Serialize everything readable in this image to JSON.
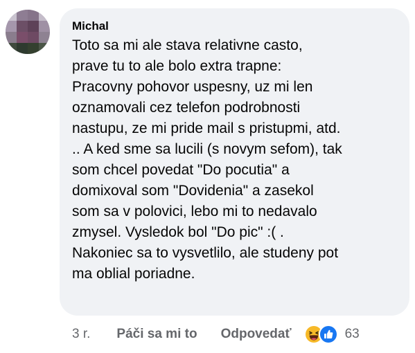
{
  "comment": {
    "author": "Michal",
    "lines": [
      "Toto sa mi ale stava relativne casto,",
      "prave tu to ale bolo extra trapne:",
      "Pracovny pohovor uspesny, uz mi len",
      "oznamovali cez telefon podrobnosti",
      "nastupu, ze mi pride mail s pristupmi, atd.",
      ".. A ked sme sa lucili (s novym sefom), tak",
      "som chcel povedat \"Do pocutia\" a",
      "domixoval som \"Dovidenia\" a zasekol",
      "som sa v polovici, lebo mi to nedavalo",
      "zmysel. Vysledok bol \"Do pic\" :( .",
      "Nakoniec sa to vysvetlilo, ale studeny pot",
      "ma oblial poriadne."
    ],
    "time": "3 r.",
    "like_label": "Páči sa mi to",
    "reply_label": "Odpovedať",
    "reaction_count": "63",
    "reaction_icons": [
      "haha-icon",
      "like-icon"
    ]
  },
  "colors": {
    "bubble": "#f0f2f5",
    "text": "#050505",
    "secondary": "#65676b",
    "like_blue": "#1877f2",
    "haha_yellow": "#f7b928"
  }
}
